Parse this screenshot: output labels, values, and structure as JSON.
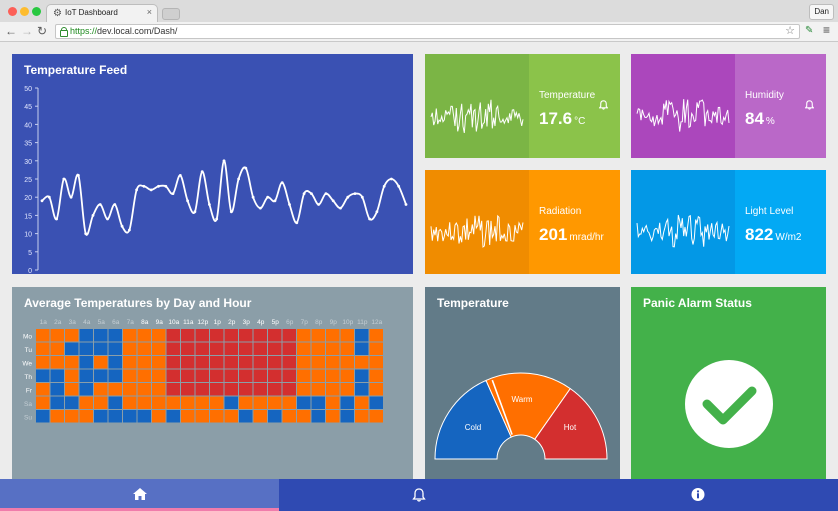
{
  "browser": {
    "tab_title": "IoT Dashboard",
    "profile": "Dan",
    "url_protocol": "https://",
    "url_rest": "dev.local.com/Dash/"
  },
  "temperature_feed": {
    "title": "Temperature Feed",
    "chart_data": {
      "type": "line",
      "title": "",
      "xlabel": "",
      "ylabel": "",
      "ylim": [
        0,
        50
      ],
      "y_ticks": [
        "0",
        "5",
        "10",
        "15",
        "20",
        "25",
        "30",
        "35",
        "40",
        "45",
        "50"
      ],
      "series": [
        {
          "values": [
            19,
            20,
            14,
            25,
            20,
            26,
            10,
            15,
            18,
            14,
            18,
            12,
            11,
            22,
            23,
            22,
            23,
            23,
            21,
            26,
            19,
            16,
            27,
            18,
            14,
            30,
            16,
            25,
            28,
            20,
            17,
            20,
            19,
            24,
            18,
            13,
            21,
            21,
            18,
            21,
            19,
            17,
            20,
            21,
            20,
            14,
            16,
            23,
            25,
            23,
            18
          ]
        }
      ],
      "color": "#ffffff",
      "grid": false
    }
  },
  "tiles": [
    {
      "label": "Temperature",
      "value": "17.6",
      "unit": "°C",
      "bell": true,
      "color_dark": "#7bb545",
      "color_light": "#8bc34a"
    },
    {
      "label": "Humidity",
      "value": "84",
      "unit": "%",
      "bell": true,
      "color_dark": "#ab47bc",
      "color_light": "#ba68c8"
    },
    {
      "label": "Radiation",
      "value": "201",
      "unit": "mrad/hr",
      "bell": false,
      "color_dark": "#f08c00",
      "color_light": "#ff9800"
    },
    {
      "label": "Light Level",
      "value": "822",
      "unit": "W/m2",
      "bell": false,
      "color_dark": "#0398e6",
      "color_light": "#03a9f4"
    }
  ],
  "heatmap": {
    "title": "Average Temperatures by Day and Hour",
    "chart_data": {
      "type": "heatmap",
      "hours": [
        "1a",
        "2a",
        "3a",
        "4a",
        "5a",
        "6a",
        "7a",
        "8a",
        "9a",
        "10a",
        "11a",
        "12p",
        "1p",
        "2p",
        "3p",
        "4p",
        "5p",
        "6p",
        "7p",
        "8p",
        "9p",
        "10p",
        "11p",
        "12a"
      ],
      "days": [
        "Mo",
        "Tu",
        "We",
        "Th",
        "Fr",
        "Sa",
        "Su"
      ],
      "levels": {
        "C": "cold",
        "W": "warm",
        "H": "hot"
      },
      "colors": {
        "C": "#1565c0",
        "W": "#ff6f00",
        "H": "#d32f2f"
      },
      "rows": [
        "WWWCCCWWWHHHHHHHHHWWWWCW",
        "WWCCCCWWWHHHHHHHHHWWWWCW",
        "WWWCWCWWWHHHHHHHHHWWWWWW",
        "CCWCCCWWWHHHHHHHHHWWWWCW",
        "WCWCWWWWWHHHHHHHHHWWWWCW",
        "WCCWWCWWWWWWWCWWWWCCWCWC",
        "CWWWCCCCWCWWWWCWCWWCWCWW"
      ]
    }
  },
  "gauge": {
    "title": "Temperature",
    "chart_data": {
      "type": "gauge",
      "bands": [
        {
          "label": "Cold",
          "color": "#1565c0"
        },
        {
          "label": "Warm",
          "color": "#ff6f00"
        },
        {
          "label": "Hot",
          "color": "#d32f2f"
        }
      ]
    }
  },
  "panic": {
    "title": "Panic Alarm Status"
  },
  "bottom_nav": {
    "items": [
      "home",
      "alerts",
      "info"
    ],
    "active": "home"
  }
}
